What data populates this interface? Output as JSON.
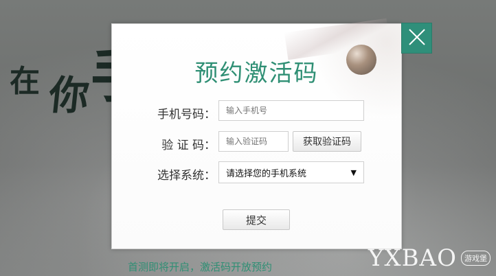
{
  "background": {
    "calligraphy": [
      "在",
      "你",
      "手"
    ]
  },
  "modal": {
    "title": "预约激活码",
    "fields": {
      "phone": {
        "label": "手机号码：",
        "placeholder": "输入手机号"
      },
      "code": {
        "label": "验 证 码：",
        "placeholder": "输入验证码",
        "button": "获取验证码"
      },
      "system": {
        "label": "选择系统：",
        "selected": "请选择您的手机系统"
      }
    },
    "submit_label": "提交"
  },
  "footer": {
    "note": "首测即将开启，激活码开放预约"
  },
  "watermark": {
    "text": "YXBAO",
    "seal_text": "游戏堡"
  },
  "colors": {
    "accent": "#2f8f74",
    "close_bg": "#2f8f7a"
  },
  "icons": {
    "close": "close-icon",
    "dropdown": "caret-down-icon"
  }
}
